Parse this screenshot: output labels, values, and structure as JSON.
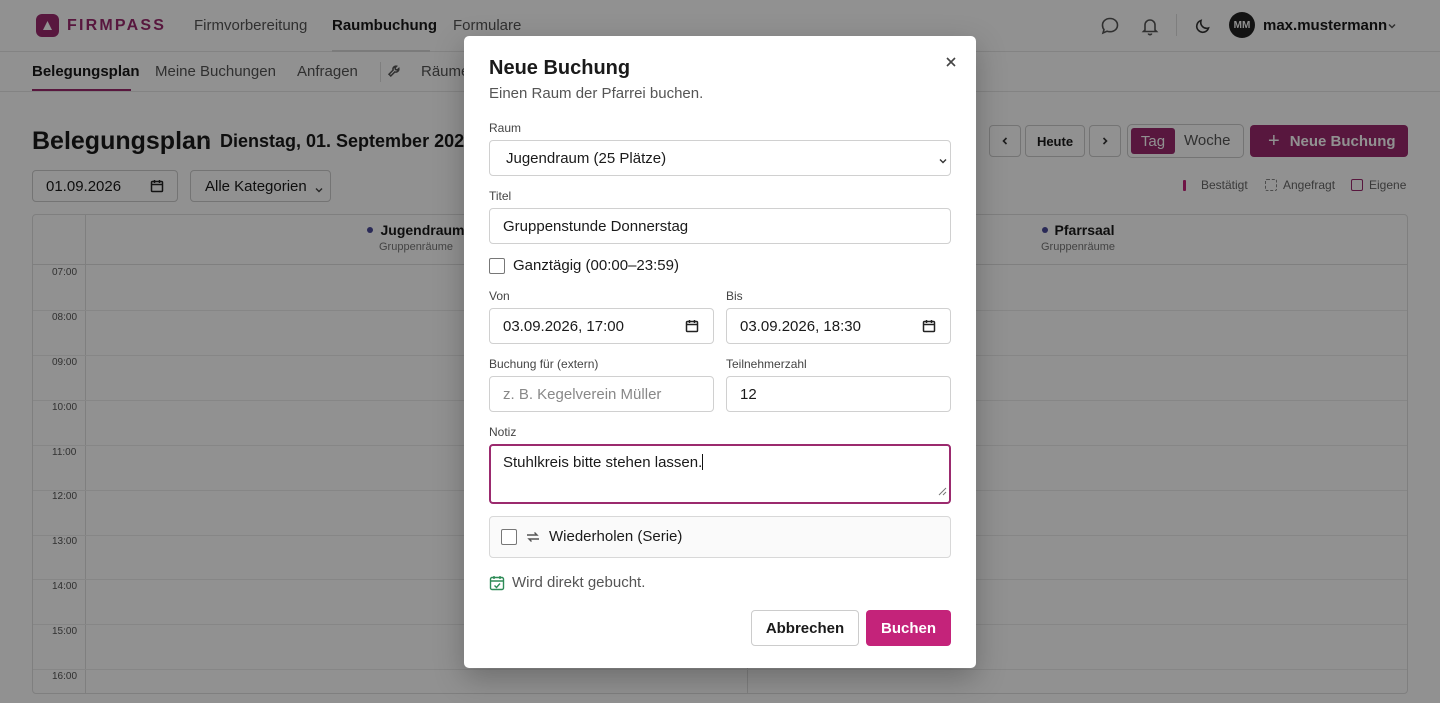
{
  "app": {
    "brand": "FIRMPASS",
    "brand_color": "#9b2a6e"
  },
  "topnav": {
    "items": [
      {
        "label": "Firmvorbereitung"
      },
      {
        "label": "Raumbuchung"
      },
      {
        "label": "Formulare"
      }
    ],
    "icons": [
      "chat-icon",
      "bell-icon",
      "moon-icon"
    ],
    "user": {
      "initials": "MM",
      "name": "max.mustermann"
    }
  },
  "subnav": {
    "items": [
      {
        "label": "Belegungsplan"
      },
      {
        "label": "Meine Buchungen"
      },
      {
        "label": "Anfragen"
      },
      {
        "label": "Räume"
      }
    ]
  },
  "page": {
    "title": "Belegungsplan",
    "separator": "·",
    "date": "Dienstag, 01. September 2026",
    "date_filter": "01.09.2026",
    "category_filter": "Alle Kategorien",
    "today_label": "Heute",
    "view_day": "Tag",
    "view_week": "Woche",
    "new_booking_label": "Neue Buchung",
    "legend": {
      "confirmed": "Bestätigt",
      "requested": "Angefragt",
      "own": "Eigene"
    }
  },
  "calendar": {
    "rooms": [
      {
        "name": "Jugendraum",
        "category": "Gruppenräume"
      },
      {
        "name": "Pfarrsaal",
        "category": "Gruppenräume"
      }
    ],
    "hours": [
      "07:00",
      "08:00",
      "09:00",
      "10:00",
      "11:00",
      "12:00",
      "13:00",
      "14:00",
      "15:00",
      "16:00"
    ]
  },
  "modal": {
    "title": "Neue Buchung",
    "subtitle": "Einen Raum der Pfarrei buchen.",
    "room_label": "Raum",
    "room_value": "Jugendraum (25 Plätze)",
    "title_label": "Titel",
    "title_value": "Gruppenstunde Donnerstag",
    "allday_label": "Ganztägig (00:00–23:59)",
    "allday_checked": false,
    "from_label": "Von",
    "from_value": "03.09.2026, 17:00",
    "to_label": "Bis",
    "to_value": "03.09.2026, 18:30",
    "external_label": "Buchung für (extern)",
    "external_placeholder": "z. B. Kegelverein Müller",
    "participants_label": "Teilnehmerzahl",
    "participants_value": "12",
    "note_label": "Notiz",
    "note_value": "Stuhlkreis bitte stehen lassen.",
    "repeat_label": "Wiederholen (Serie)",
    "repeat_checked": false,
    "status_text": "Wird direkt gebucht.",
    "cancel_label": "Abbrechen",
    "submit_label": "Buchen"
  }
}
